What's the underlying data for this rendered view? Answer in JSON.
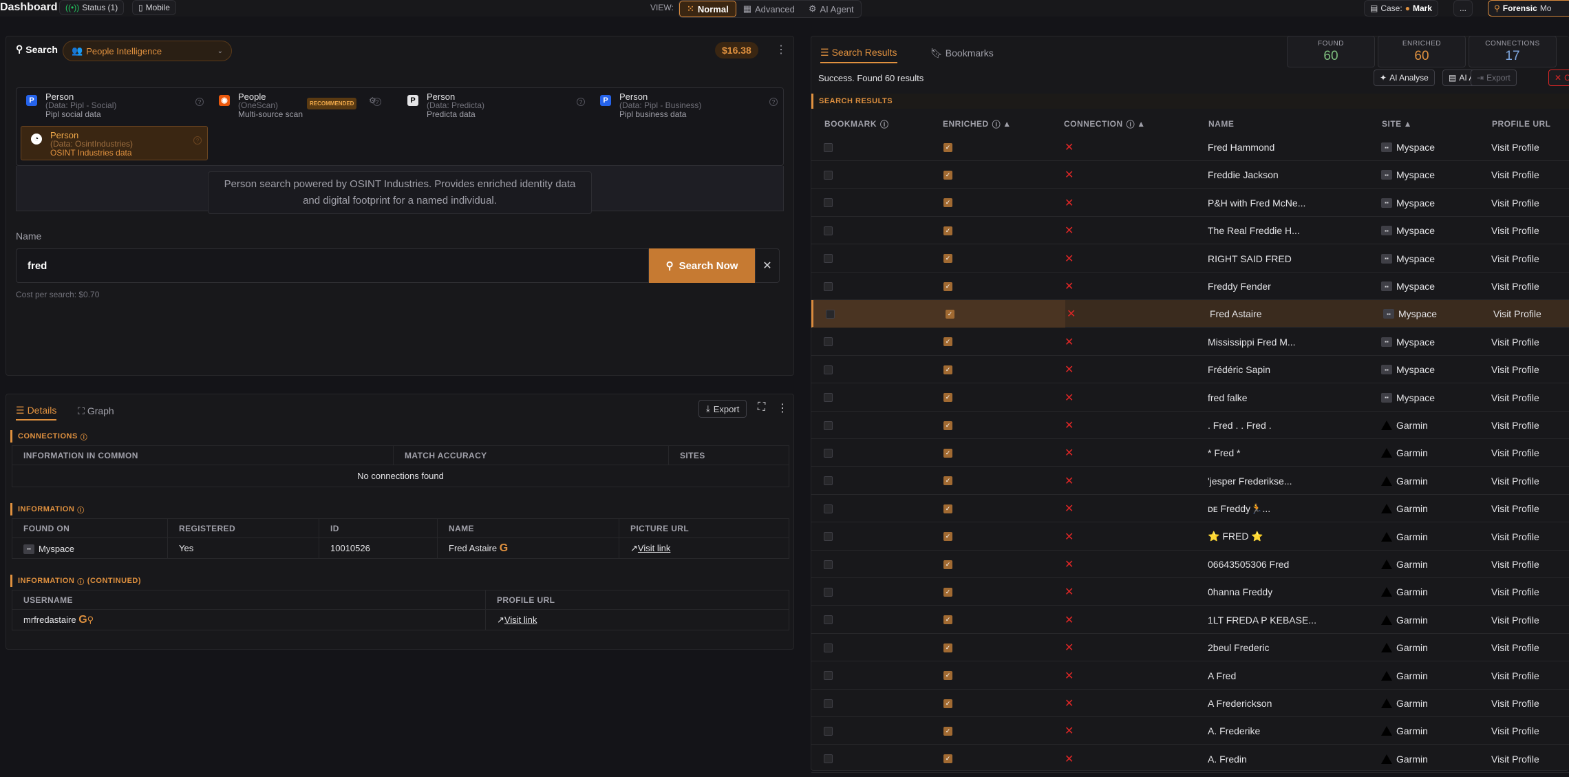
{
  "app": {
    "title": "Dashboard",
    "status_label": "Status (1)",
    "mobile_label": "Mobile",
    "view_label": "VIEW:",
    "views": [
      "Normal",
      "Advanced",
      "AI Agent"
    ],
    "case_label": "Case:",
    "case_name": "Mark",
    "more_label": "...",
    "forensic_label": "Forensic",
    "forensic_extra": "Mo"
  },
  "search": {
    "label": "Search",
    "category": "People Intelligence",
    "balance": "$16.38",
    "name_label": "Name",
    "name_value": "fred",
    "button": "Search Now",
    "cost": "Cost per search: $0.70",
    "description": "Person search powered by OSINT Industries. Provides enriched identity data and digital footprint for a named individual."
  },
  "sources": [
    {
      "title": "Person",
      "sub": "(Data: Pipl - Social)",
      "desc": "Pipl social data"
    },
    {
      "title": "People",
      "sub": "(OneScan)",
      "desc": "Multi-source scan",
      "badge": "RECOMMENDED"
    },
    {
      "title": "Person",
      "sub": "(Data: Predicta)",
      "desc": "Predicta data"
    },
    {
      "title": "Person",
      "sub": "(Data: Pipl - Business)",
      "desc": "Pipl business data"
    },
    {
      "title": "Person",
      "sub": "(Data: OsintIndustries)",
      "desc": "OSINT Industries data"
    }
  ],
  "details": {
    "tab_details": "Details",
    "tab_graph": "Graph",
    "export": "Export",
    "connections_title": "CONNECTIONS",
    "conn_headers": [
      "INFORMATION IN COMMON",
      "MATCH ACCURACY",
      "SITES"
    ],
    "conn_empty": "No connections found",
    "info_title": "INFORMATION",
    "info_headers": [
      "FOUND ON",
      "REGISTERED",
      "ID",
      "NAME",
      "PICTURE URL"
    ],
    "info_row": {
      "found_on": "Myspace",
      "registered": "Yes",
      "id": "10010526",
      "name": "Fred Astaire",
      "picture": "Visit link"
    },
    "info2_title": "INFORMATION",
    "info2_suffix": "(CONTINUED)",
    "info2_headers": [
      "USERNAME",
      "PROFILE URL"
    ],
    "info2_row": {
      "username": "mrfredastaire",
      "profile": "Visit link"
    }
  },
  "results": {
    "tab_results": "Search Results",
    "tab_bookmarks": "Bookmarks",
    "status": "Success. Found 60 results",
    "section": "SEARCH RESULTS",
    "stats": [
      {
        "label": "FOUND",
        "value": "60",
        "color": "#7fbf7f"
      },
      {
        "label": "ENRICHED",
        "value": "60",
        "color": "#e0913f"
      },
      {
        "label": "CONNECTIONS",
        "value": "17",
        "color": "#7fa7df"
      }
    ],
    "actions": [
      "AI Analyse",
      "AI Ask",
      "Export",
      "C"
    ],
    "headers": [
      "BOOKMARK",
      "ENRICHED",
      "CONNECTION",
      "NAME",
      "SITE",
      "PROFILE URL"
    ],
    "rows": [
      {
        "name": "Fred Hammond",
        "site": "Myspace",
        "link": "Visit Profile"
      },
      {
        "name": "Freddie Jackson",
        "site": "Myspace",
        "link": "Visit Profile"
      },
      {
        "name": "P&H with Fred McNe...",
        "site": "Myspace",
        "link": "Visit Profile"
      },
      {
        "name": "The Real Freddie H...",
        "site": "Myspace",
        "link": "Visit Profile"
      },
      {
        "name": "RIGHT SAID FRED",
        "site": "Myspace",
        "link": "Visit Profile"
      },
      {
        "name": "Freddy Fender",
        "site": "Myspace",
        "link": "Visit Profile"
      },
      {
        "name": "Fred Astaire",
        "site": "Myspace",
        "link": "Visit Profile",
        "selected": true
      },
      {
        "name": "Mississippi Fred M...",
        "site": "Myspace",
        "link": "Visit Profile"
      },
      {
        "name": "Frédéric Sapin",
        "site": "Myspace",
        "link": "Visit Profile"
      },
      {
        "name": "fred falke",
        "site": "Myspace",
        "link": "Visit Profile"
      },
      {
        "name": ". Fred . . Fred .",
        "site": "Garmin",
        "link": "Visit Profile"
      },
      {
        "name": "* Fred *",
        "site": "Garmin",
        "link": "Visit Profile"
      },
      {
        "name": "'jesper Frederikse...",
        "site": "Garmin",
        "link": "Visit Profile"
      },
      {
        "name": "ᴅᴇ Freddy🏃...",
        "site": "Garmin",
        "link": "Visit Profile"
      },
      {
        "name": "⭐ FRED ⭐",
        "site": "Garmin",
        "link": "Visit Profile"
      },
      {
        "name": "06643505306 Fred",
        "site": "Garmin",
        "link": "Visit Profile"
      },
      {
        "name": "0hanna Freddy",
        "site": "Garmin",
        "link": "Visit Profile"
      },
      {
        "name": "1LT FREDA P KEBASE...",
        "site": "Garmin",
        "link": "Visit Profile"
      },
      {
        "name": "2beul Frederic",
        "site": "Garmin",
        "link": "Visit Profile"
      },
      {
        "name": "A Fred",
        "site": "Garmin",
        "link": "Visit Profile"
      },
      {
        "name": "A Frederickson",
        "site": "Garmin",
        "link": "Visit Profile"
      },
      {
        "name": "A. Frederike",
        "site": "Garmin",
        "link": "Visit Profile"
      },
      {
        "name": "A. Fredin",
        "site": "Garmin",
        "link": "Visit Profile"
      }
    ]
  }
}
